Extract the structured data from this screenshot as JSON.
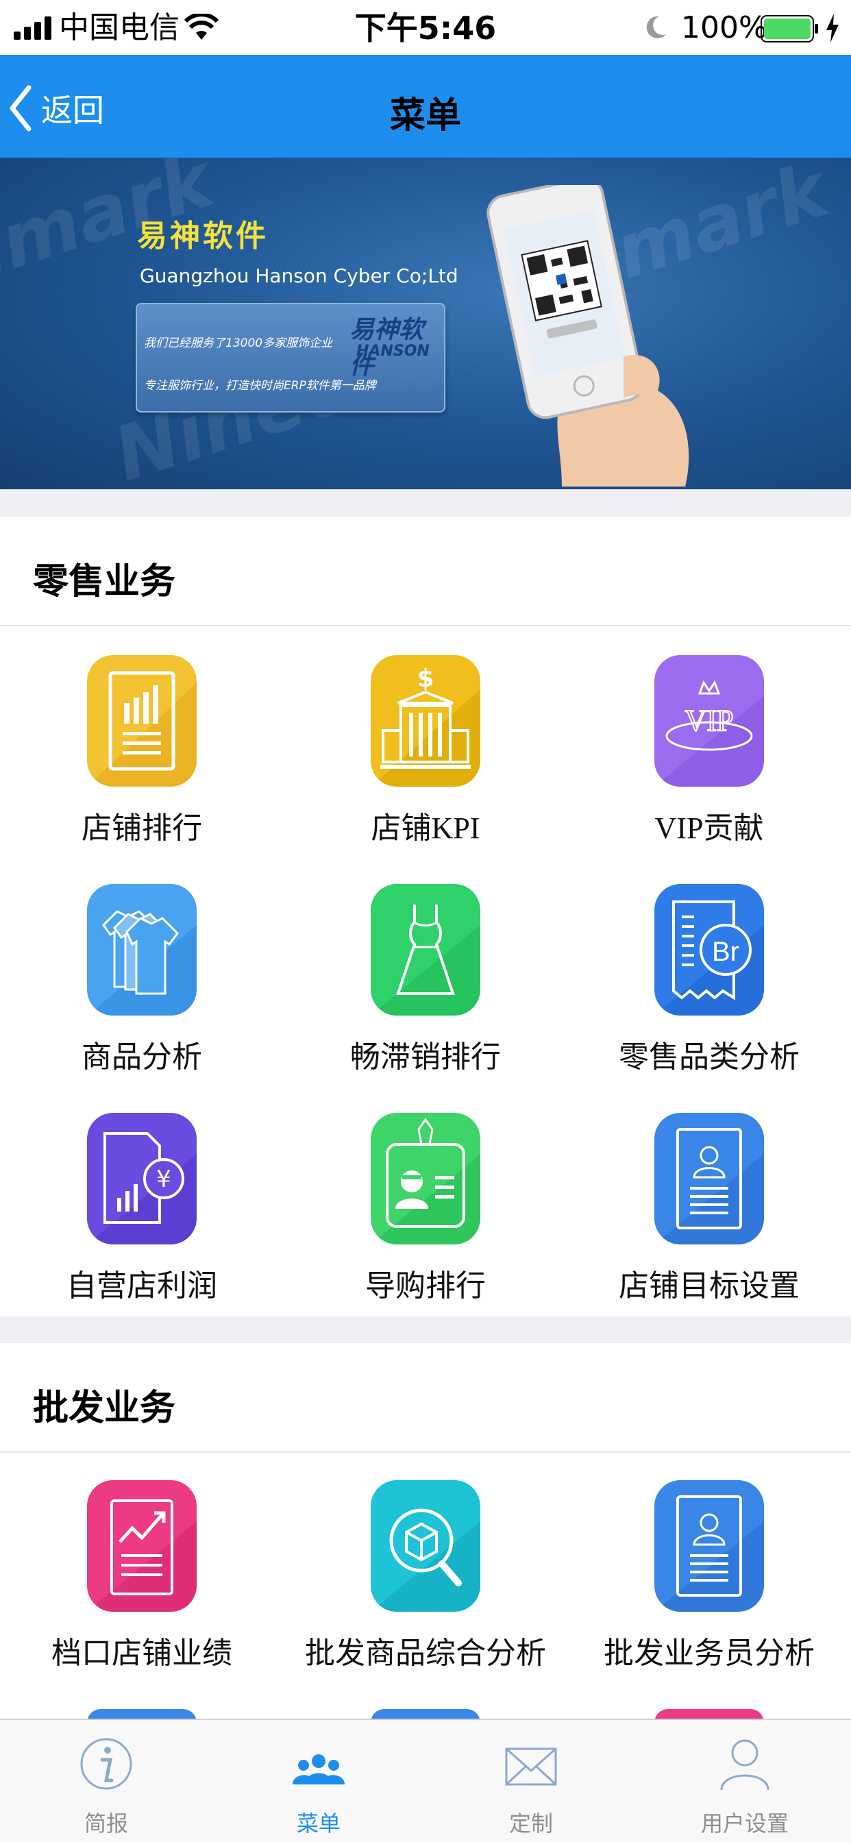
{
  "status_bar": {
    "carrier": "中国电信",
    "time": "下午5:46",
    "battery_percent": "100%",
    "icons": [
      "signal-icon",
      "wifi-icon",
      "moon-icon",
      "battery-icon",
      "charging-icon"
    ]
  },
  "nav": {
    "back_label": "返回",
    "title": "菜单",
    "bar_color": "#1d8dee"
  },
  "banner": {
    "company_cn": "易神软件",
    "company_en": "Guangzhou Hanson Cyber Co;Ltd",
    "card_line1": "我们已经服务了13000多家服饰企业",
    "card_line2": "专注服饰行业，打造快时尚ERP软件第一品牌",
    "card_brand": "易神软件",
    "card_brand_en": "HANSON"
  },
  "sections": [
    {
      "title": "零售业务",
      "items": [
        {
          "label": "店铺排行",
          "icon": "bar-chart-document-icon",
          "color": "#f2c230"
        },
        {
          "label": "店铺KPI",
          "icon": "bank-building-icon",
          "color": "#f0bf1e"
        },
        {
          "label": "VIP贡献",
          "icon": "vip-crown-icon",
          "color": "#9b6cf0"
        },
        {
          "label": "商品分析",
          "icon": "shirts-icon",
          "color": "#4aa3f0"
        },
        {
          "label": "畅滞销排行",
          "icon": "dress-icon",
          "color": "#2ed16a"
        },
        {
          "label": "零售品类分析",
          "icon": "brand-receipt-icon",
          "color": "#2f7be8"
        },
        {
          "label": "自营店利润",
          "icon": "yuan-report-icon",
          "color": "#6a4be0"
        },
        {
          "label": "导购排行",
          "icon": "staff-badge-icon",
          "color": "#3ed46a"
        },
        {
          "label": "店铺目标设置",
          "icon": "profile-document-icon",
          "color": "#3a86e6"
        }
      ]
    },
    {
      "title": "批发业务",
      "items": [
        {
          "label": "档口店铺业绩",
          "icon": "trend-chart-icon",
          "color": "#ec3a84"
        },
        {
          "label": "批发商品综合分析",
          "icon": "package-search-icon",
          "color": "#1fc3d6"
        },
        {
          "label": "批发业务员分析",
          "icon": "profile-document-icon",
          "color": "#3a86e6"
        }
      ]
    }
  ],
  "tabs": [
    {
      "label": "简报",
      "icon": "info-icon",
      "active": false
    },
    {
      "label": "菜单",
      "icon": "group-icon",
      "active": true
    },
    {
      "label": "定制",
      "icon": "mail-icon",
      "active": false
    },
    {
      "label": "用户设置",
      "icon": "user-icon",
      "active": false
    }
  ]
}
